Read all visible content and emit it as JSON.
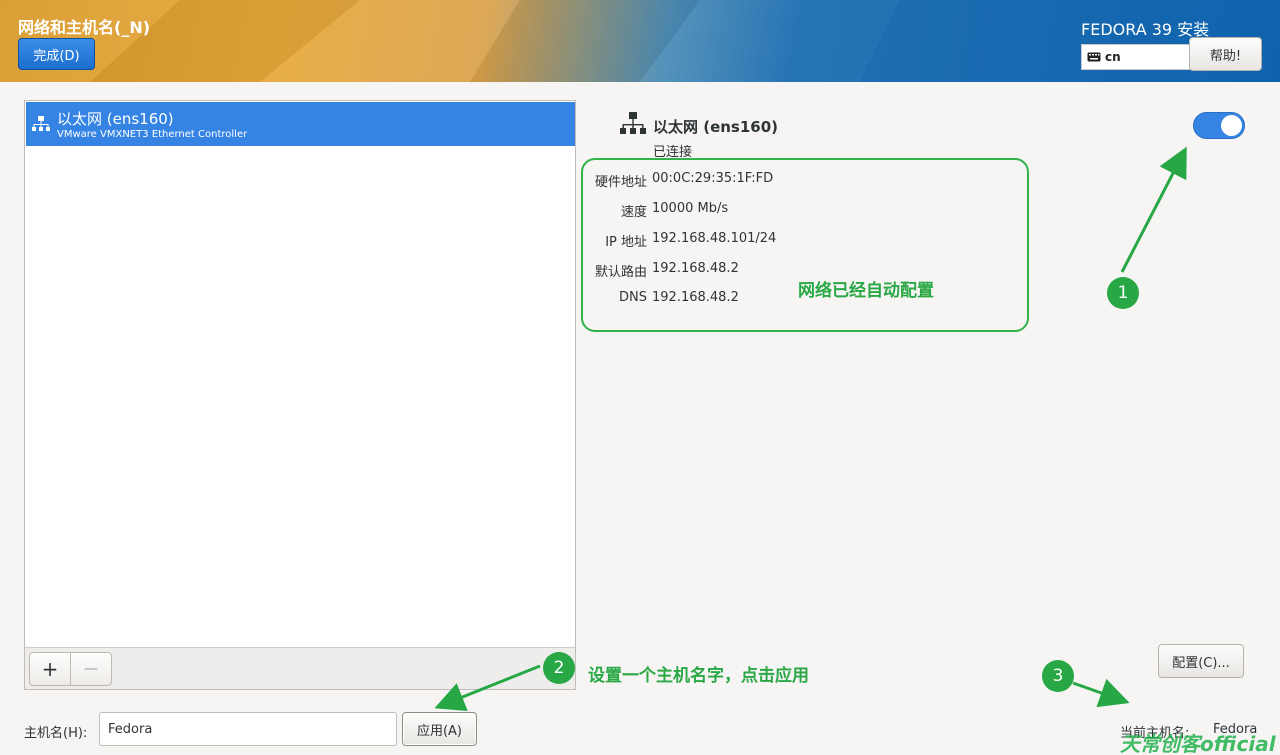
{
  "header": {
    "title": "网络和主机名(_N)",
    "done_label": "完成(D)",
    "product": "FEDORA 39 安装",
    "keyboard_layout": "cn",
    "help_label": "帮助!"
  },
  "device_list": {
    "items": [
      {
        "name": "以太网 (ens160)",
        "description": "VMware VMXNET3 Ethernet Controller",
        "icon": "network-wired-icon",
        "selected": true
      }
    ],
    "add_label": "+",
    "remove_label": "—"
  },
  "details": {
    "name": "以太网 (ens160)",
    "status": "已连接",
    "enabled": true,
    "rows": [
      {
        "label": "硬件地址",
        "value": "00:0C:29:35:1F:FD"
      },
      {
        "label": "速度",
        "value": "10000 Mb/s"
      },
      {
        "label": "IP 地址",
        "value": "192.168.48.101/24"
      },
      {
        "label": "默认路由",
        "value": "192.168.48.2"
      },
      {
        "label": "DNS",
        "value": "192.168.48.2"
      }
    ],
    "config_label": "配置(C)..."
  },
  "hostname": {
    "label": "主机名(H):",
    "value": "Fedora",
    "apply_label": "应用(A)",
    "current_label": "当前主机名:",
    "current_value": "Fedora"
  },
  "annotations": {
    "box_text": "网络已经自动配置",
    "step2_text": "设置一个主机名字，点击应用",
    "badges": [
      "1",
      "2",
      "3"
    ],
    "color": "#27a844"
  },
  "watermark": "天常创客official"
}
